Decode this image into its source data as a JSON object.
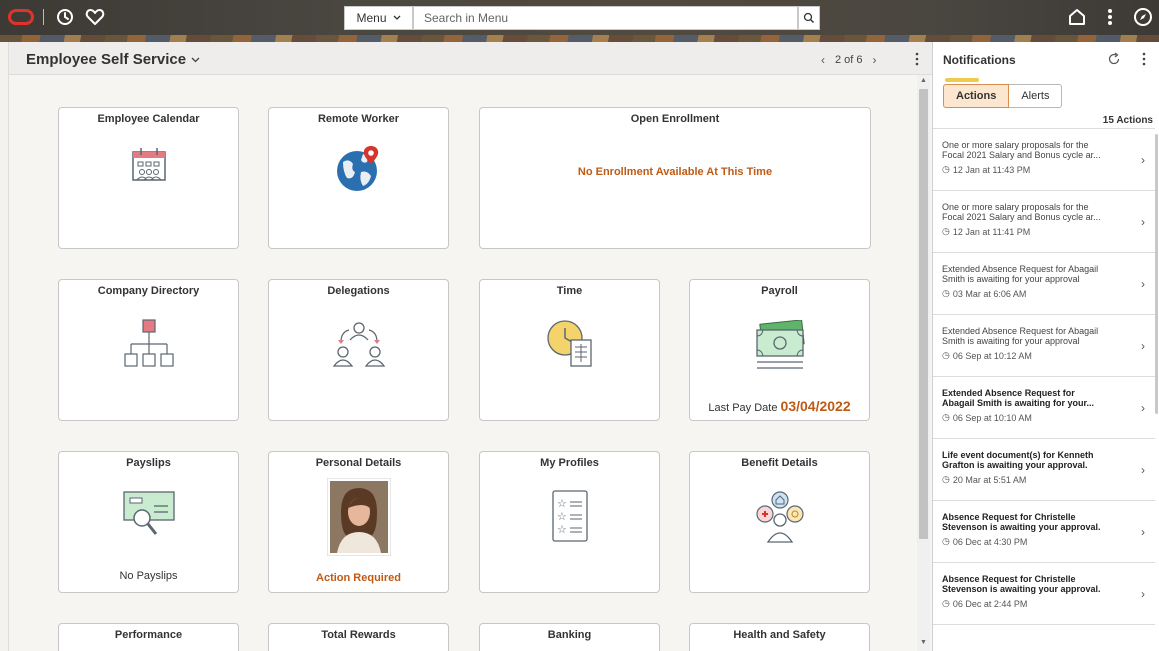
{
  "topbar": {
    "menu_label": "Menu",
    "search_placeholder": "Search in Menu"
  },
  "page": {
    "title": "Employee Self Service",
    "pager": "2 of 6"
  },
  "tiles": {
    "employee_calendar": {
      "title": "Employee Calendar"
    },
    "remote_worker": {
      "title": "Remote Worker"
    },
    "open_enrollment": {
      "title": "Open Enrollment",
      "message": "No Enrollment Available At This Time"
    },
    "company_directory": {
      "title": "Company Directory"
    },
    "delegations": {
      "title": "Delegations"
    },
    "time": {
      "title": "Time"
    },
    "payroll": {
      "title": "Payroll",
      "last_pay_label": "Last Pay Date",
      "last_pay_date": "03/04/2022"
    },
    "payslips": {
      "title": "Payslips",
      "note": "No Payslips"
    },
    "personal_details": {
      "title": "Personal Details",
      "note": "Action Required"
    },
    "my_profiles": {
      "title": "My Profiles"
    },
    "benefit_details": {
      "title": "Benefit Details"
    },
    "performance": {
      "title": "Performance"
    },
    "total_rewards": {
      "title": "Total Rewards"
    },
    "banking": {
      "title": "Banking"
    },
    "health_safety": {
      "title": "Health and Safety"
    }
  },
  "notifications": {
    "title": "Notifications",
    "tabs": [
      {
        "label": "Actions"
      },
      {
        "label": "Alerts"
      }
    ],
    "count": "15 Actions",
    "items": [
      {
        "line1": "One or more salary proposals for the",
        "line2": "Focal 2021 Salary and Bonus cycle ar...",
        "time": "12 Jan at 11:43 PM"
      },
      {
        "line1": "One or more salary proposals for the",
        "line2": "Focal 2021 Salary and Bonus cycle ar...",
        "time": "12 Jan at 11:41 PM"
      },
      {
        "line1": "Extended Absence Request for Abagail",
        "line2": "Smith is awaiting for your approval",
        "time": "03 Mar at 6:06 AM"
      },
      {
        "line1": "Extended Absence Request for Abagail",
        "line2": "Smith is awaiting for your approval",
        "time": "06 Sep at 10:12 AM"
      },
      {
        "line1": "Extended Absence Request for",
        "line2": "Abagail Smith is awaiting for your...",
        "time": "06 Sep at 10:10 AM"
      },
      {
        "line1": "Life event document(s) for Kenneth",
        "line2": "Grafton is awaiting your approval.",
        "time": "20 Mar at 5:51 AM"
      },
      {
        "line1": "Absence Request for Christelle",
        "line2": "Stevenson is awaiting your approval.",
        "time": "06 Dec at 4:30 PM"
      },
      {
        "line1": "Absence Request for Christelle",
        "line2": "Stevenson is awaiting your approval.",
        "time": "06 Dec at 2:44 PM"
      }
    ]
  },
  "colors": {
    "accent_orange": "#c05a14",
    "oracle_red": "#e2332a",
    "active_tab_bg": "#fde6cf"
  }
}
